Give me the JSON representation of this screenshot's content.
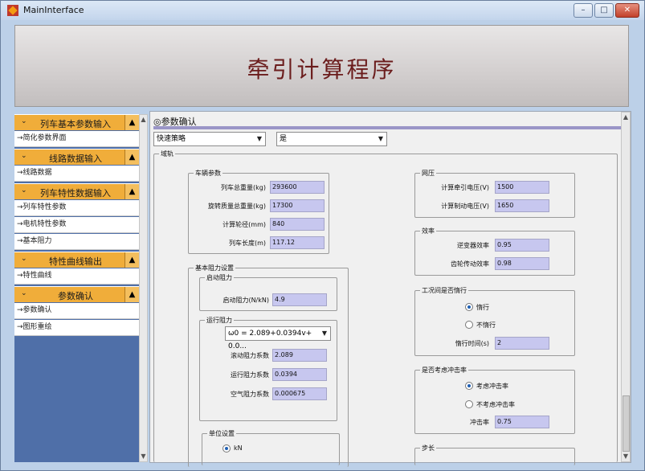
{
  "window": {
    "title": "MainInterface",
    "min_label": "–",
    "max_label": "□",
    "close_label": "✕"
  },
  "banner": {
    "title": "牵引计算程序"
  },
  "sidebar": {
    "sections": [
      {
        "label": "列车基本参数输入",
        "chevron": "⌄",
        "arrow": "▲",
        "items": [
          "→简化参数界面"
        ]
      },
      {
        "label": "线路数据输入",
        "chevron": "⌄",
        "arrow": "▲",
        "items": [
          "→线路数据"
        ]
      },
      {
        "label": "列车特性数据输入",
        "chevron": "⌄",
        "arrow": "▲",
        "items": [
          "→列车特性参数",
          "→电机特性参数",
          "→基本阻力"
        ]
      },
      {
        "label": "特性曲线输出",
        "chevron": "⌄",
        "arrow": "▲",
        "items": [
          "→特性曲线"
        ]
      },
      {
        "label": "参数确认",
        "chevron": "⌄",
        "arrow": "▲",
        "items": [
          "→参数确认",
          "→图形重绘"
        ]
      }
    ],
    "scroll_up": "▲",
    "scroll_down": "▼"
  },
  "main": {
    "title": "◎参数确认",
    "strategy_select": "快速策略",
    "yes_select": "是",
    "outer_group": "域轨",
    "vehicle": {
      "legend": "车辆参数",
      "fields": [
        {
          "label": "列车总重量(kg)",
          "value": "293600"
        },
        {
          "label": "旋转质量总重量(kg)",
          "value": "17300"
        },
        {
          "label": "计算轮径(mm)",
          "value": "840"
        },
        {
          "label": "列车长度(m)",
          "value": "117.12"
        }
      ]
    },
    "network": {
      "legend": "网压",
      "fields": [
        {
          "label": "计算牵引电压(V)",
          "value": "1500"
        },
        {
          "label": "计算制动电压(V)",
          "value": "1650"
        }
      ]
    },
    "efficiency": {
      "legend": "效率",
      "fields": [
        {
          "label": "逆变器效率",
          "value": "0.95"
        },
        {
          "label": "齿轮传动效率",
          "value": "0.98"
        }
      ]
    },
    "resistance": {
      "legend": "基本阻力设置",
      "start": {
        "legend": "启动阻力",
        "label": "启动阻力(N/kN)",
        "value": "4.9"
      },
      "running": {
        "legend": "运行阻力",
        "formula": "ω0 = 2.089+0.0394v+ 0.0...",
        "fields": [
          {
            "label": "滚动阻力系数",
            "value": "2.089"
          },
          {
            "label": "运行阻力系数",
            "value": "0.0394"
          },
          {
            "label": "空气阻力系数",
            "value": "0.000675"
          }
        ]
      }
    },
    "coasting": {
      "legend": "工况间是否惰行",
      "opt_yes": "惰行",
      "opt_no": "不惰行",
      "time_label": "惰行时间(s)",
      "time_value": "2"
    },
    "impact": {
      "legend": "是否考虑冲击率",
      "opt_yes": "考虑冲击率",
      "opt_no": "不考虑冲击率",
      "rate_label": "冲击率",
      "rate_value": "0.75"
    },
    "unit": {
      "legend": "单位设置",
      "opt": "kN"
    },
    "step": {
      "legend": "步长"
    },
    "scroll_up": "▲",
    "scroll_down": "▼"
  }
}
